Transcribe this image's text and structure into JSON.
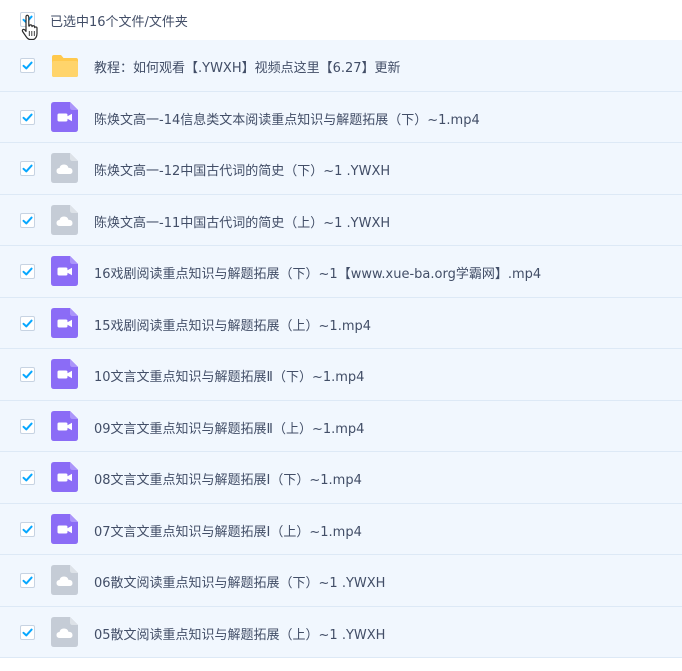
{
  "header": {
    "selection_text": "已选中16个文件/文件夹",
    "checked": true
  },
  "colors": {
    "check": "#06a7ff",
    "video_icon": "#8b6cf6",
    "cloud_icon": "#c5ccd6",
    "folder_icon": "#ffc94d",
    "row_bg": "#f1f7fe"
  },
  "files": [
    {
      "name": "教程：如何观看【.YWXH】视频点这里【6.27】更新",
      "icon": "folder-icon",
      "checked": true
    },
    {
      "name": "陈焕文高一-14信息类文本阅读重点知识与解题拓展（下）~1.mp4",
      "icon": "video-file-icon",
      "checked": true
    },
    {
      "name": "陈焕文高一-12中国古代词的简史（下）~1 .YWXH",
      "icon": "cloud-file-icon",
      "checked": true
    },
    {
      "name": "陈焕文高一-11中国古代词的简史（上）~1 .YWXH",
      "icon": "cloud-file-icon",
      "checked": true
    },
    {
      "name": "16戏剧阅读重点知识与解题拓展（下）~1【www.xue-ba.org学霸网】.mp4",
      "icon": "video-file-icon",
      "checked": true
    },
    {
      "name": "15戏剧阅读重点知识与解题拓展（上）~1.mp4",
      "icon": "video-file-icon",
      "checked": true
    },
    {
      "name": "10文言文重点知识与解题拓展Ⅱ（下）~1.mp4",
      "icon": "video-file-icon",
      "checked": true
    },
    {
      "name": "09文言文重点知识与解题拓展Ⅱ（上）~1.mp4",
      "icon": "video-file-icon",
      "checked": true
    },
    {
      "name": "08文言文重点知识与解题拓展Ⅰ（下）~1.mp4",
      "icon": "video-file-icon",
      "checked": true
    },
    {
      "name": "07文言文重点知识与解题拓展Ⅰ（上）~1.mp4",
      "icon": "video-file-icon",
      "checked": true
    },
    {
      "name": "06散文阅读重点知识与解题拓展（下）~1 .YWXH",
      "icon": "cloud-file-icon",
      "checked": true
    },
    {
      "name": "05散文阅读重点知识与解题拓展（上）~1 .YWXH",
      "icon": "cloud-file-icon",
      "checked": true
    }
  ]
}
